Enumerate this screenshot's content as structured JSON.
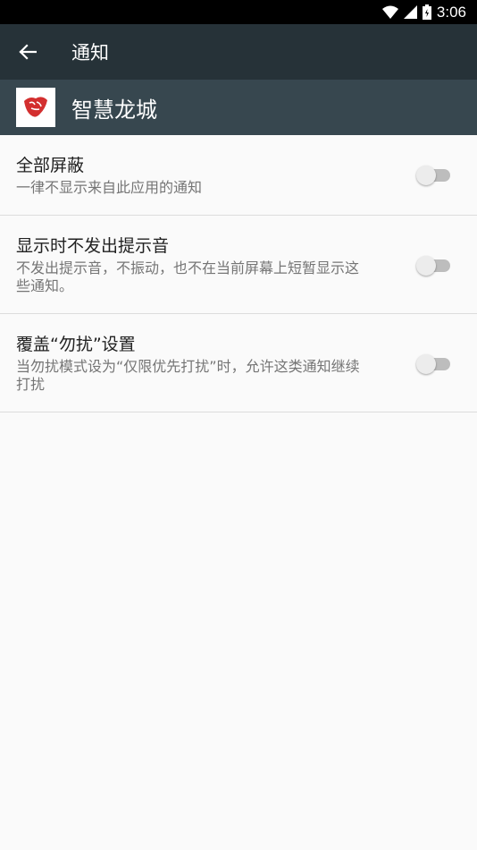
{
  "status_bar": {
    "time": "3:06",
    "icons": [
      "wifi-icon",
      "cell-signal-icon",
      "battery-icon"
    ]
  },
  "toolbar": {
    "back_icon": "arrow-back-icon",
    "title": "通知"
  },
  "app": {
    "name": "智慧龙城",
    "icon": "app-logo"
  },
  "settings": [
    {
      "title": "全部屏蔽",
      "subtitle": "一律不显示来自此应用的通知",
      "enabled": false
    },
    {
      "title": "显示时不发出提示音",
      "subtitle_line1": "不发出提示音，不振动，也不在当前屏幕上短暂显示这",
      "subtitle_line2": "些通知。",
      "enabled": false
    },
    {
      "title": "覆盖“勿扰”设置",
      "subtitle_line1": "当勿扰模式设为“仅限优先打扰”时，允许这类通知继续",
      "subtitle_line2": "打扰",
      "enabled": false
    }
  ],
  "colors": {
    "toolbar": "#263238",
    "app_header": "#37474f",
    "background": "#fafafa",
    "logo_red": "#d32f2f"
  }
}
